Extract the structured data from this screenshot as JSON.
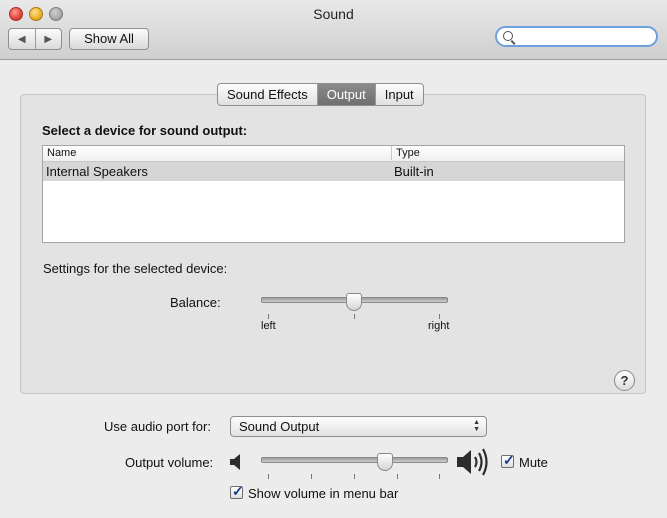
{
  "window": {
    "title": "Sound"
  },
  "toolbar": {
    "back_icon": "back-arrow-icon",
    "forward_icon": "forward-arrow-icon",
    "back_glyph": "◀",
    "forward_glyph": "▶",
    "show_all_label": "Show All",
    "search_placeholder": "",
    "search_icon": "magnifier-icon"
  },
  "tabs": [
    {
      "label": "Sound Effects",
      "active": false
    },
    {
      "label": "Output",
      "active": true
    },
    {
      "label": "Input",
      "active": false
    }
  ],
  "output": {
    "section_title": "Select a device for sound output:",
    "table": {
      "columns": [
        "Name",
        "Type"
      ],
      "rows": [
        {
          "name": "Internal Speakers",
          "type": "Built-in",
          "selected": true
        }
      ]
    },
    "settings_label": "Settings for the selected device:",
    "balance": {
      "label": "Balance:",
      "left_label": "left",
      "right_label": "right",
      "value": 0.5
    },
    "help_label": "?"
  },
  "audio_port": {
    "label": "Use audio port for:",
    "selected": "Sound Output"
  },
  "volume": {
    "label": "Output volume:",
    "value": 0.67,
    "low_icon": "speaker-low-icon",
    "high_icon": "speaker-high-icon",
    "mute_label": "Mute",
    "mute_checked": true
  },
  "menu_bar_option": {
    "label": "Show volume in menu bar",
    "checked": true
  },
  "colors": {
    "active_tab": "#7a7a7a",
    "search_focus": "#6fa0de",
    "checkmark": "#1a3a8a"
  }
}
